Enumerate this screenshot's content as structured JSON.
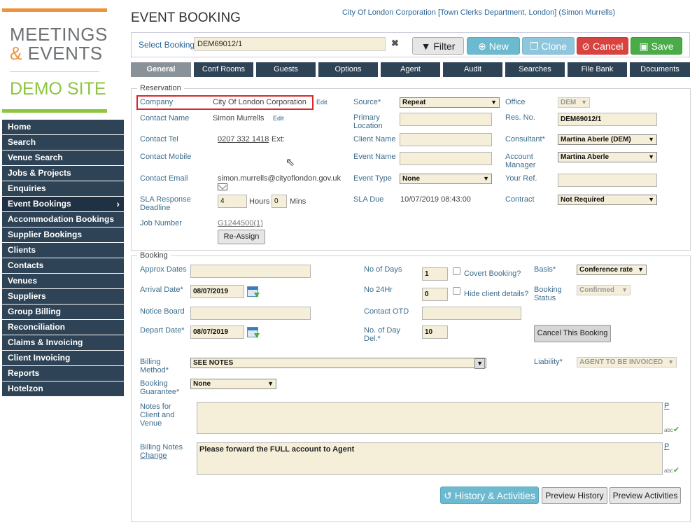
{
  "logo": {
    "line1": "MEETINGS",
    "amp": "&",
    "line2": " EVENTS",
    "demo": "DEMO SITE"
  },
  "nav": [
    {
      "label": "Home"
    },
    {
      "label": "Search"
    },
    {
      "label": "Venue Search"
    },
    {
      "label": "Jobs & Projects"
    },
    {
      "label": "Enquiries"
    },
    {
      "label": "Event Bookings",
      "active": true
    },
    {
      "label": "Accommodation Bookings"
    },
    {
      "label": "Supplier Bookings"
    },
    {
      "label": "Clients"
    },
    {
      "label": "Contacts"
    },
    {
      "label": "Venues"
    },
    {
      "label": "Suppliers"
    },
    {
      "label": "Group Billing"
    },
    {
      "label": "Reconciliation"
    },
    {
      "label": "Claims & Invoicing"
    },
    {
      "label": "Client Invoicing"
    },
    {
      "label": "Reports"
    },
    {
      "label": "Hotelzon"
    }
  ],
  "header": {
    "title": "EVENT BOOKING",
    "user_info": "City Of London Corporation [Town Clerks Department, London] (Simon Murrells)"
  },
  "select_booking": {
    "label": "Select Booking",
    "value": "DEM69012/1",
    "clear": "✖"
  },
  "toolbar": {
    "filter": "Filter",
    "new": "New",
    "clone": "Clone",
    "cancel": "Cancel",
    "save": "Save"
  },
  "tabs": [
    "General",
    "Conf Rooms",
    "Guests",
    "Options",
    "Agent",
    "Audit",
    "Searches",
    "File Bank",
    "Documents"
  ],
  "reservation": {
    "legend": "Reservation",
    "company_label": "Company",
    "company_value": "City Of London Corporation",
    "edit": "Edit",
    "contact_name_label": "Contact Name",
    "contact_name_value": "Simon Murrells",
    "contact_tel_label": "Contact Tel",
    "contact_tel_value": "0207 332 1418",
    "ext": "Ext:",
    "contact_mobile_label": "Contact Mobile",
    "contact_email_label": "Contact Email",
    "contact_email_value": "simon.murrells@cityoflondon.gov.uk",
    "sla_label1": "SLA Response",
    "sla_label2": "Deadline",
    "sla_hours": "4",
    "hours": "Hours",
    "sla_mins": "0",
    "mins": "Mins",
    "job_number_label": "Job Number",
    "job_number_value": "G1244500",
    "job_number_count": "(1)",
    "reassign": "Re-Assign",
    "source_label": "Source*",
    "source_value": "Repeat",
    "primary_location_label1": "Primary",
    "primary_location_label2": "Location",
    "client_name_label": "Client Name",
    "event_name_label": "Event Name",
    "event_type_label": "Event Type",
    "event_type_value": "None",
    "sla_due_label": "SLA Due",
    "sla_due_value": "10/07/2019 08:43:00",
    "office_label": "Office",
    "office_value": "DEM",
    "res_no_label": "Res. No.",
    "res_no_value": "DEM69012/1",
    "consultant_label": "Consultant*",
    "consultant_value": "Martina Aberle (DEM)",
    "account_manager_label1": "Account",
    "account_manager_label2": "Manager",
    "account_manager_value": "Martina Aberle",
    "your_ref_label": "Your Ref.",
    "contract_label": "Contract",
    "contract_value": "Not Required"
  },
  "booking": {
    "legend": "Booking",
    "approx_dates_label": "Approx Dates",
    "arrival_label": "Arrival Date*",
    "arrival_value": "08/07/2019",
    "notice_board_label": "Notice Board",
    "depart_label": "Depart Date*",
    "depart_value": "08/07/2019",
    "no_days_label": "No of Days",
    "no_days_value": "1",
    "covert_label": "Covert Booking?",
    "no_24hr_label": "No 24Hr",
    "no_24hr_value": "0",
    "hide_client_label": "Hide client details?",
    "contact_otd_label": "Contact OTD",
    "day_del_label1": "No. of Day",
    "day_del_label2": "Del.*",
    "day_del_value": "10",
    "basis_label": "Basis*",
    "basis_value": "Conference rate",
    "booking_status_label1": "Booking",
    "booking_status_label2": "Status",
    "booking_status_value": "Confirmed",
    "cancel_booking": "Cancel This Booking",
    "billing_method_label1": "Billing",
    "billing_method_label2": "Method*",
    "billing_method_value": "SEE NOTES",
    "liability_label": "Liability*",
    "liability_value": "AGENT TO BE INVOICED",
    "guarantee_label1": "Booking",
    "guarantee_label2": "Guarantee*",
    "guarantee_value": "None",
    "notes_label1": "Notes for",
    "notes_label2": "Client and",
    "notes_label3": "Venue",
    "notes_value": "",
    "billing_notes_label": "Billing Notes",
    "change": "Change",
    "billing_notes_value": "Please forward the FULL account to Agent",
    "p_marker": "P",
    "spell": "abc"
  },
  "footer": {
    "history": "History & Activities",
    "preview_history": "Preview History",
    "preview_activities": "Preview Activities"
  }
}
